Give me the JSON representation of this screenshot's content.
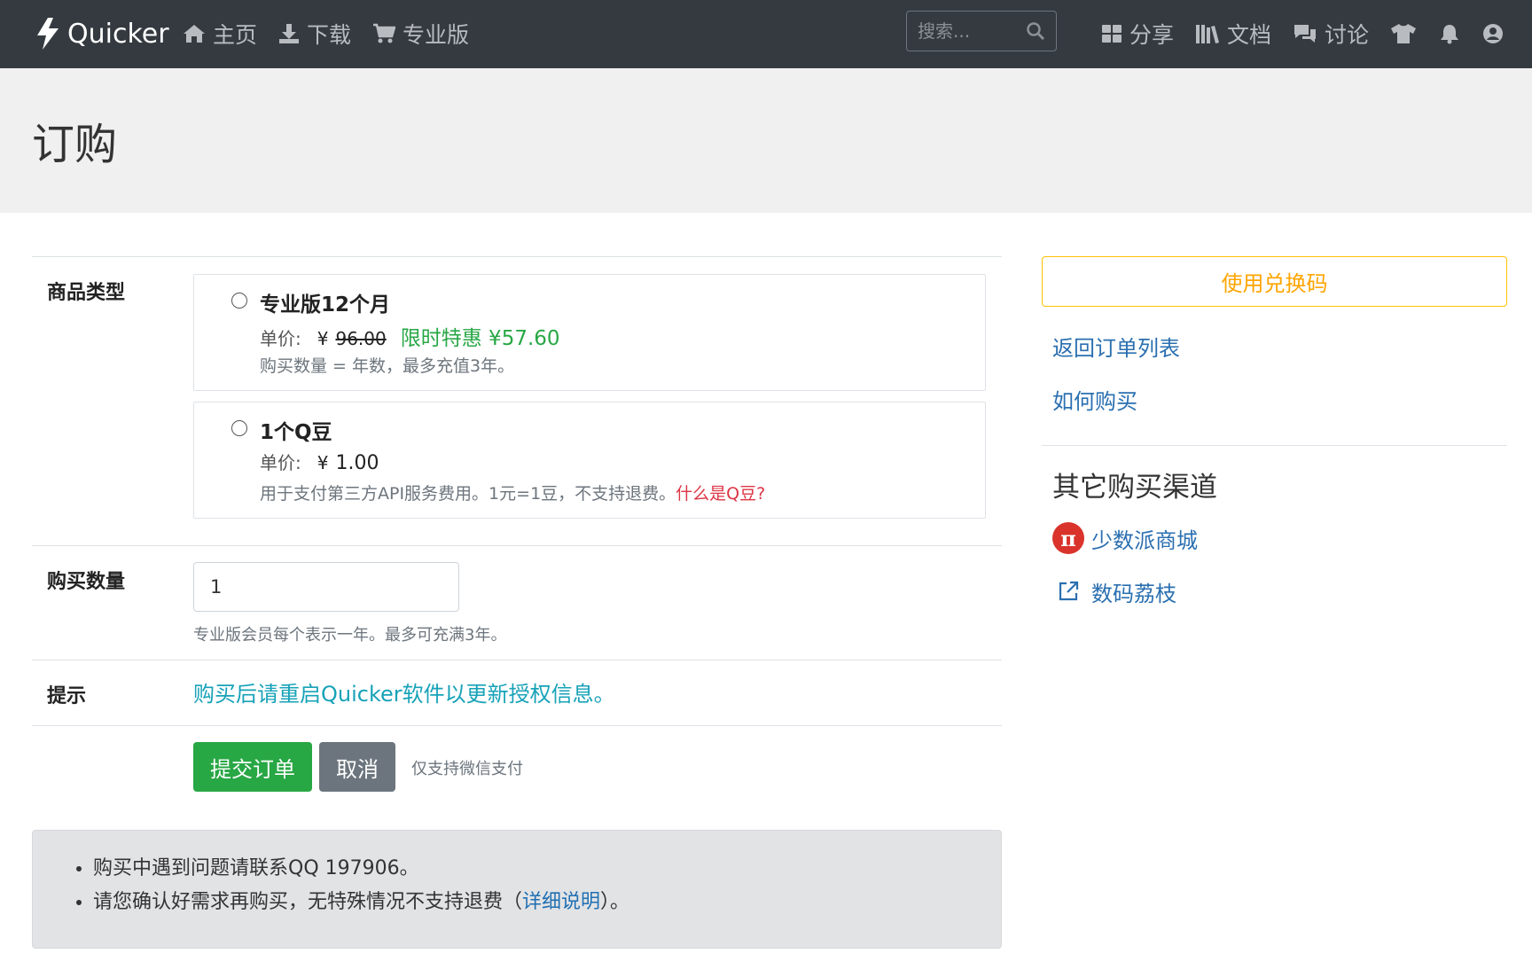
{
  "navbar": {
    "brand": "Quicker",
    "left_items": [
      {
        "icon": "home-icon",
        "label": "主页"
      },
      {
        "icon": "download-icon",
        "label": "下载"
      },
      {
        "icon": "cart-icon",
        "label": "专业版"
      }
    ],
    "search_placeholder": "搜索...",
    "right_items": [
      {
        "icon": "grid-icon",
        "label": "分享"
      },
      {
        "icon": "library-icon",
        "label": "文档"
      },
      {
        "icon": "comments-icon",
        "label": "讨论"
      }
    ],
    "right_icons": [
      "tshirt-icon",
      "bell-icon",
      "user-icon"
    ]
  },
  "page": {
    "title": "订购"
  },
  "form": {
    "product_type_label": "商品类型",
    "options": [
      {
        "title": "专业版12个月",
        "price_label": "单价:",
        "currency": "¥",
        "original_price": "96.00",
        "sale_text": "限时特惠 ¥57.60",
        "description": "购买数量 = 年数，最多充值3年。"
      },
      {
        "title": "1个Q豆",
        "price_label": "单价:",
        "currency": "¥",
        "price": "1.00",
        "description": "用于支付第三方API服务费用。1元=1豆，不支持退费。",
        "help_link": "什么是Q豆?"
      }
    ],
    "quantity_label": "购买数量",
    "quantity_value": "1",
    "quantity_help": "专业版会员每个表示一年。最多可充满3年。",
    "tip_label": "提示",
    "tip_text": "购买后请重启Quicker软件以更新授权信息。",
    "submit_label": "提交订单",
    "cancel_label": "取消",
    "pay_note": "仅支持微信支付"
  },
  "notice": {
    "line1": "购买中遇到问题请联系QQ 197906。",
    "line2_prefix": "请您确认好需求再购买，无特殊情况不支持退费（",
    "line2_link": "详细说明",
    "line2_suffix": "）。"
  },
  "sidebar": {
    "redeem_label": "使用兑换码",
    "links": [
      "返回订单列表",
      "如何购买"
    ],
    "other_heading": "其它购买渠道",
    "channels": [
      {
        "icon": "pi-icon",
        "label": "少数派商城"
      },
      {
        "icon": "external-link-icon",
        "label": "数码荔枝"
      }
    ]
  },
  "colors": {
    "navbar_bg": "#343a40",
    "success": "#28a745",
    "secondary": "#6c757d",
    "warning": "#ffc107",
    "info": "#17a2b8",
    "danger": "#dc3545",
    "link": "#2a6fb0"
  }
}
